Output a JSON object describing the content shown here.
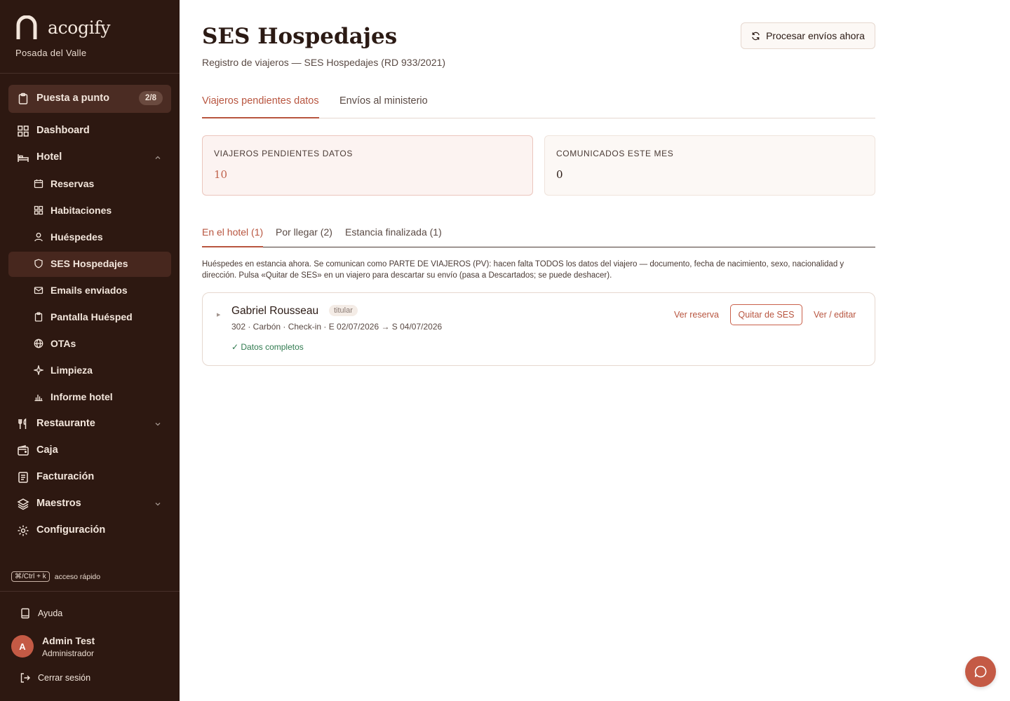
{
  "brand": {
    "name": "acogify",
    "property": "Posada del Valle"
  },
  "setup": {
    "label": "Puesta a punto",
    "progress": "2/8"
  },
  "nav": {
    "dashboard": "Dashboard",
    "hotel": "Hotel",
    "hotel_items": {
      "reservas": "Reservas",
      "habitaciones": "Habitaciones",
      "huespedes": "Huéspedes",
      "ses": "SES Hospedajes",
      "emails": "Emails enviados",
      "pantalla": "Pantalla Huésped",
      "otas": "OTAs",
      "limpieza": "Limpieza",
      "informe": "Informe hotel"
    },
    "restaurante": "Restaurante",
    "caja": "Caja",
    "facturacion": "Facturación",
    "maestros": "Maestros",
    "configuracion": "Configuración"
  },
  "quick_access": {
    "shortcut": "⌘/Ctrl + k",
    "label": "acceso rápido"
  },
  "footer": {
    "help": "Ayuda",
    "logout": "Cerrar sesión"
  },
  "user": {
    "initial": "A",
    "name": "Admin Test",
    "role": "Administrador"
  },
  "page": {
    "title": "SES Hospedajes",
    "subtitle": "Registro de viajeros — SES Hospedajes (RD 933/2021)",
    "process_button": "Procesar envíos ahora"
  },
  "tabs": {
    "pending": "Viajeros pendientes datos",
    "sent": "Envíos al ministerio"
  },
  "stats": {
    "pending_label": "VIAJEROS PENDIENTES DATOS",
    "pending_value": "10",
    "month_label": "COMUNICADOS ESTE MES",
    "month_value": "0"
  },
  "subtabs": {
    "in_hotel": "En el hotel (1)",
    "arriving": "Por llegar (2)",
    "finished": "Estancia finalizada (1)"
  },
  "info_text": "Huéspedes en estancia ahora. Se comunican como PARTE DE VIAJEROS (PV): hacen falta TODOS los datos del viajero — documento, fecha de nacimiento, sexo, nacionalidad y dirección. Pulsa «Quitar de SES» en un viajero para descartar su envío (pasa a Descartados; se puede deshacer).",
  "guest": {
    "name": "Gabriel Rousseau",
    "tag": "titular",
    "meta": "302 · Carbón · Check-in · E 02/07/2026 → S 04/07/2026",
    "status": "✓ Datos completos",
    "view_booking": "Ver reserva",
    "remove": "Quitar de SES",
    "edit": "Ver / editar"
  },
  "colors": {
    "sidebar_bg": "#2d1811",
    "accent": "#b8553f",
    "success": "#2f7a4f"
  }
}
